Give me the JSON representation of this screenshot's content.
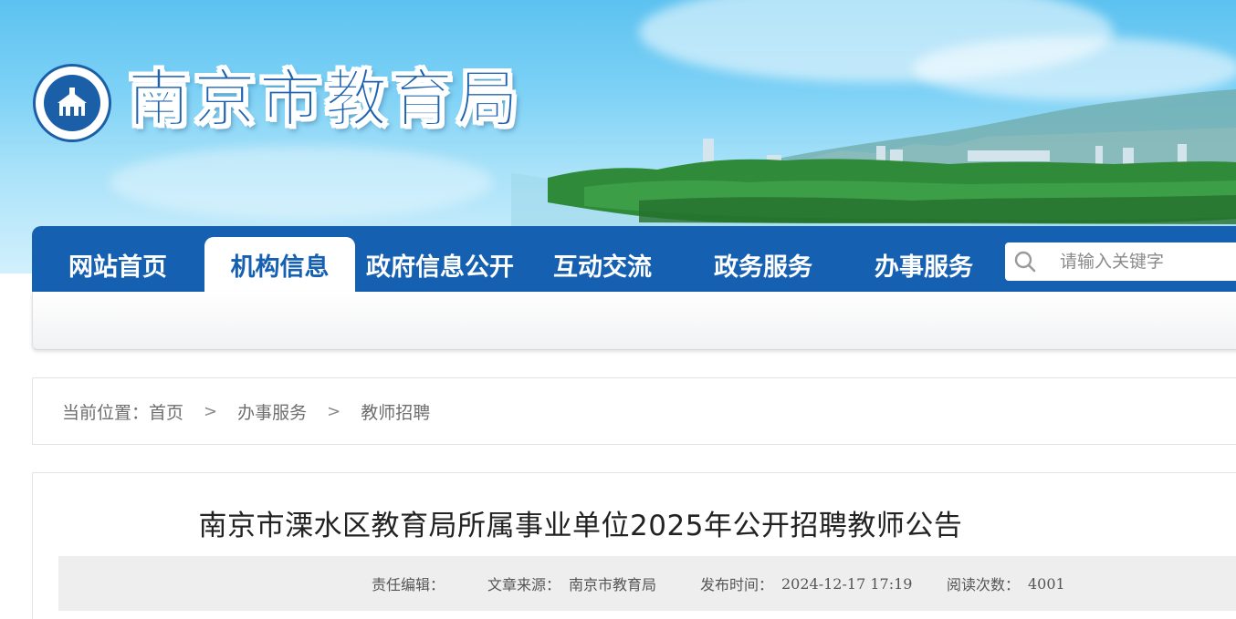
{
  "header": {
    "site_title": "南京市教育局",
    "emblem_label": "CHINA NANJING EDUCATION",
    "emblem_icon": "nanjing-education-emblem"
  },
  "nav": {
    "items": [
      {
        "label": "网站首页",
        "active": false
      },
      {
        "label": "机构信息",
        "active": true
      },
      {
        "label": "政府信息公开",
        "active": false
      },
      {
        "label": "互动交流",
        "active": false
      },
      {
        "label": "政务服务",
        "active": false
      },
      {
        "label": "办事服务",
        "active": false
      }
    ],
    "search": {
      "placeholder": "请输入关键字",
      "value": "",
      "icon": "search-icon"
    }
  },
  "breadcrumb": {
    "prefix": "当前位置：",
    "items": [
      "首页",
      "办事服务",
      "教师招聘"
    ],
    "separator": ">"
  },
  "article": {
    "title": "南京市溧水区教育局所属事业单位2025年公开招聘教师公告",
    "meta": {
      "editor_label": "责任编辑：",
      "editor_value": "",
      "source_label": "文章来源：",
      "source_value": "南京市教育局",
      "time_label": "发布时间：",
      "time_value": "2024-12-17 17:19",
      "views_label": "阅读次数：",
      "views_value": "4001"
    }
  },
  "colors": {
    "brand_blue": "#1660b2",
    "sky_top": "#5cc2f0",
    "meta_bg": "#eeeeee"
  }
}
